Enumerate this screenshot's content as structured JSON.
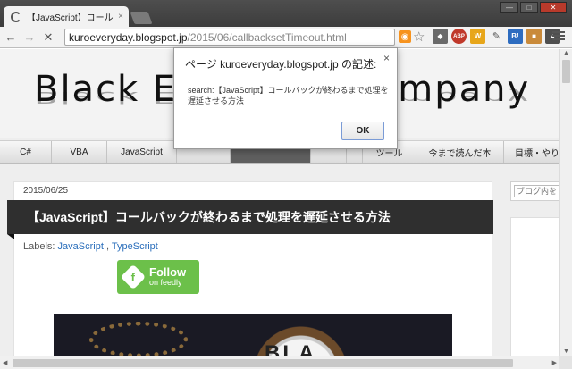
{
  "browser": {
    "tab_title": "【JavaScript】コールバ",
    "tab_close": "×",
    "url_host": "kuroeveryday.blogspot.jp",
    "url_path": "/2015/06/callbacksetTimeout.html",
    "window_controls": {
      "minimize": "—",
      "maximize": "□",
      "close": "✕"
    },
    "extensions": [
      {
        "label": "ABP",
        "color": "#c0392b"
      },
      {
        "label": "W",
        "color": "#e7a61a"
      },
      {
        "label": "B!",
        "color": "#2d6cc0"
      }
    ]
  },
  "site": {
    "title": "Black Everyday Company",
    "nav": [
      {
        "label": "C#",
        "active": false
      },
      {
        "label": "VBA",
        "active": false
      },
      {
        "label": "JavaScript",
        "active": false
      },
      {
        "label": "",
        "active": false
      },
      {
        "label": "",
        "active": true
      },
      {
        "label": "",
        "active": false
      },
      {
        "label": "",
        "active": false
      },
      {
        "label": "ツール",
        "active": false
      },
      {
        "label": "今まで読んだ本",
        "active": false
      },
      {
        "label": "目標・やり",
        "active": false
      }
    ]
  },
  "post": {
    "date": "2015/06/25",
    "title": "【JavaScript】コールバックが終わるまで処理を遅延させる方法",
    "labels_prefix": "Labels:",
    "labels": [
      "JavaScript",
      "TypeScript"
    ],
    "labels_sep": ",",
    "follow_main": "Follow",
    "follow_sub": "on feedly",
    "image_digits": "BLA"
  },
  "sidebar": {
    "search_placeholder": "ブログ内を"
  },
  "dialog": {
    "title": "ページ kuroeveryday.blogspot.jp の記述:",
    "message": "search:【JavaScript】コールバックが終わるまで処理を遅延させる方法",
    "ok_label": "OK",
    "close_label": "×"
  }
}
